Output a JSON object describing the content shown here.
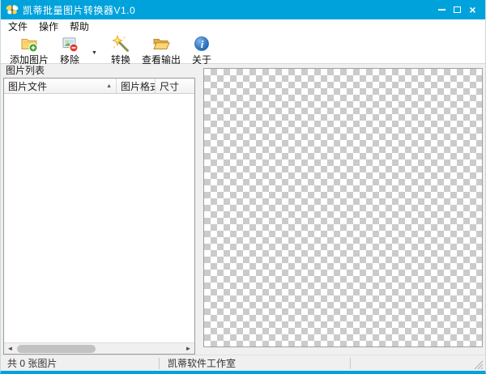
{
  "window": {
    "title": "凯蒂批量图片转换器V1.0",
    "titlebar_color": "#00a2dc",
    "close_glyph": "×"
  },
  "menu": {
    "items": [
      {
        "label": "文件"
      },
      {
        "label": "操作"
      },
      {
        "label": "帮助"
      }
    ]
  },
  "toolbar": {
    "buttons": [
      {
        "label": "添加图片",
        "icon": "add-images-folder-plus-icon"
      },
      {
        "label": "移除",
        "icon": "remove-image-minus-icon",
        "has_dropdown": true
      },
      {
        "label": "转换",
        "icon": "convert-magic-wand-icon"
      },
      {
        "label": "查看输出",
        "icon": "view-output-open-folder-icon"
      },
      {
        "label": "关于",
        "icon": "about-info-icon"
      }
    ],
    "dropdown_glyph": "▼"
  },
  "image_list": {
    "title": "图片列表",
    "columns": [
      {
        "label": "图片文件",
        "sort": "asc",
        "sort_glyph": "▲"
      },
      {
        "label": "图片格式"
      },
      {
        "label": "尺寸"
      }
    ],
    "rows": [],
    "scrollbar": {
      "left_glyph": "◄",
      "right_glyph": "►"
    }
  },
  "preview": {
    "kind": "transparency-checkerboard",
    "checker_dark": "#cbcbcb",
    "checker_light": "#ffffff",
    "checker_size_px": 8
  },
  "status_bar": {
    "left": "共 0 张图片",
    "center": "凯蒂软件工作室",
    "right": ""
  }
}
